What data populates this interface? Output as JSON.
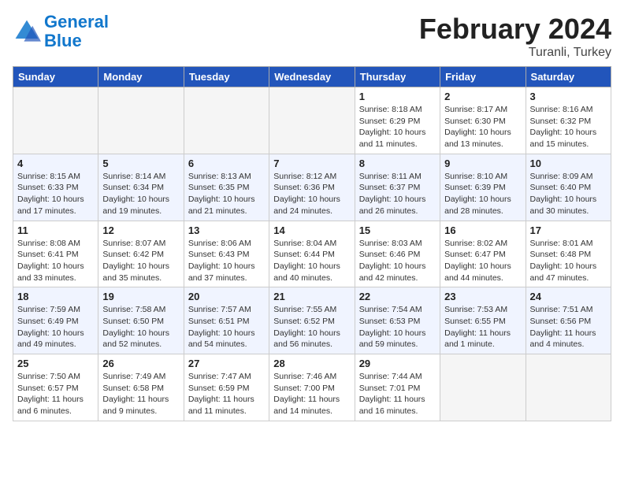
{
  "header": {
    "logo_line1": "General",
    "logo_line2": "Blue",
    "title": "February 2024",
    "subtitle": "Turanli, Turkey"
  },
  "weekdays": [
    "Sunday",
    "Monday",
    "Tuesday",
    "Wednesday",
    "Thursday",
    "Friday",
    "Saturday"
  ],
  "weeks": [
    [
      {
        "day": "",
        "info": ""
      },
      {
        "day": "",
        "info": ""
      },
      {
        "day": "",
        "info": ""
      },
      {
        "day": "",
        "info": ""
      },
      {
        "day": "1",
        "info": "Sunrise: 8:18 AM\nSunset: 6:29 PM\nDaylight: 10 hours\nand 11 minutes."
      },
      {
        "day": "2",
        "info": "Sunrise: 8:17 AM\nSunset: 6:30 PM\nDaylight: 10 hours\nand 13 minutes."
      },
      {
        "day": "3",
        "info": "Sunrise: 8:16 AM\nSunset: 6:32 PM\nDaylight: 10 hours\nand 15 minutes."
      }
    ],
    [
      {
        "day": "4",
        "info": "Sunrise: 8:15 AM\nSunset: 6:33 PM\nDaylight: 10 hours\nand 17 minutes."
      },
      {
        "day": "5",
        "info": "Sunrise: 8:14 AM\nSunset: 6:34 PM\nDaylight: 10 hours\nand 19 minutes."
      },
      {
        "day": "6",
        "info": "Sunrise: 8:13 AM\nSunset: 6:35 PM\nDaylight: 10 hours\nand 21 minutes."
      },
      {
        "day": "7",
        "info": "Sunrise: 8:12 AM\nSunset: 6:36 PM\nDaylight: 10 hours\nand 24 minutes."
      },
      {
        "day": "8",
        "info": "Sunrise: 8:11 AM\nSunset: 6:37 PM\nDaylight: 10 hours\nand 26 minutes."
      },
      {
        "day": "9",
        "info": "Sunrise: 8:10 AM\nSunset: 6:39 PM\nDaylight: 10 hours\nand 28 minutes."
      },
      {
        "day": "10",
        "info": "Sunrise: 8:09 AM\nSunset: 6:40 PM\nDaylight: 10 hours\nand 30 minutes."
      }
    ],
    [
      {
        "day": "11",
        "info": "Sunrise: 8:08 AM\nSunset: 6:41 PM\nDaylight: 10 hours\nand 33 minutes."
      },
      {
        "day": "12",
        "info": "Sunrise: 8:07 AM\nSunset: 6:42 PM\nDaylight: 10 hours\nand 35 minutes."
      },
      {
        "day": "13",
        "info": "Sunrise: 8:06 AM\nSunset: 6:43 PM\nDaylight: 10 hours\nand 37 minutes."
      },
      {
        "day": "14",
        "info": "Sunrise: 8:04 AM\nSunset: 6:44 PM\nDaylight: 10 hours\nand 40 minutes."
      },
      {
        "day": "15",
        "info": "Sunrise: 8:03 AM\nSunset: 6:46 PM\nDaylight: 10 hours\nand 42 minutes."
      },
      {
        "day": "16",
        "info": "Sunrise: 8:02 AM\nSunset: 6:47 PM\nDaylight: 10 hours\nand 44 minutes."
      },
      {
        "day": "17",
        "info": "Sunrise: 8:01 AM\nSunset: 6:48 PM\nDaylight: 10 hours\nand 47 minutes."
      }
    ],
    [
      {
        "day": "18",
        "info": "Sunrise: 7:59 AM\nSunset: 6:49 PM\nDaylight: 10 hours\nand 49 minutes."
      },
      {
        "day": "19",
        "info": "Sunrise: 7:58 AM\nSunset: 6:50 PM\nDaylight: 10 hours\nand 52 minutes."
      },
      {
        "day": "20",
        "info": "Sunrise: 7:57 AM\nSunset: 6:51 PM\nDaylight: 10 hours\nand 54 minutes."
      },
      {
        "day": "21",
        "info": "Sunrise: 7:55 AM\nSunset: 6:52 PM\nDaylight: 10 hours\nand 56 minutes."
      },
      {
        "day": "22",
        "info": "Sunrise: 7:54 AM\nSunset: 6:53 PM\nDaylight: 10 hours\nand 59 minutes."
      },
      {
        "day": "23",
        "info": "Sunrise: 7:53 AM\nSunset: 6:55 PM\nDaylight: 11 hours\nand 1 minute."
      },
      {
        "day": "24",
        "info": "Sunrise: 7:51 AM\nSunset: 6:56 PM\nDaylight: 11 hours\nand 4 minutes."
      }
    ],
    [
      {
        "day": "25",
        "info": "Sunrise: 7:50 AM\nSunset: 6:57 PM\nDaylight: 11 hours\nand 6 minutes."
      },
      {
        "day": "26",
        "info": "Sunrise: 7:49 AM\nSunset: 6:58 PM\nDaylight: 11 hours\nand 9 minutes."
      },
      {
        "day": "27",
        "info": "Sunrise: 7:47 AM\nSunset: 6:59 PM\nDaylight: 11 hours\nand 11 minutes."
      },
      {
        "day": "28",
        "info": "Sunrise: 7:46 AM\nSunset: 7:00 PM\nDaylight: 11 hours\nand 14 minutes."
      },
      {
        "day": "29",
        "info": "Sunrise: 7:44 AM\nSunset: 7:01 PM\nDaylight: 11 hours\nand 16 minutes."
      },
      {
        "day": "",
        "info": ""
      },
      {
        "day": "",
        "info": ""
      }
    ]
  ]
}
